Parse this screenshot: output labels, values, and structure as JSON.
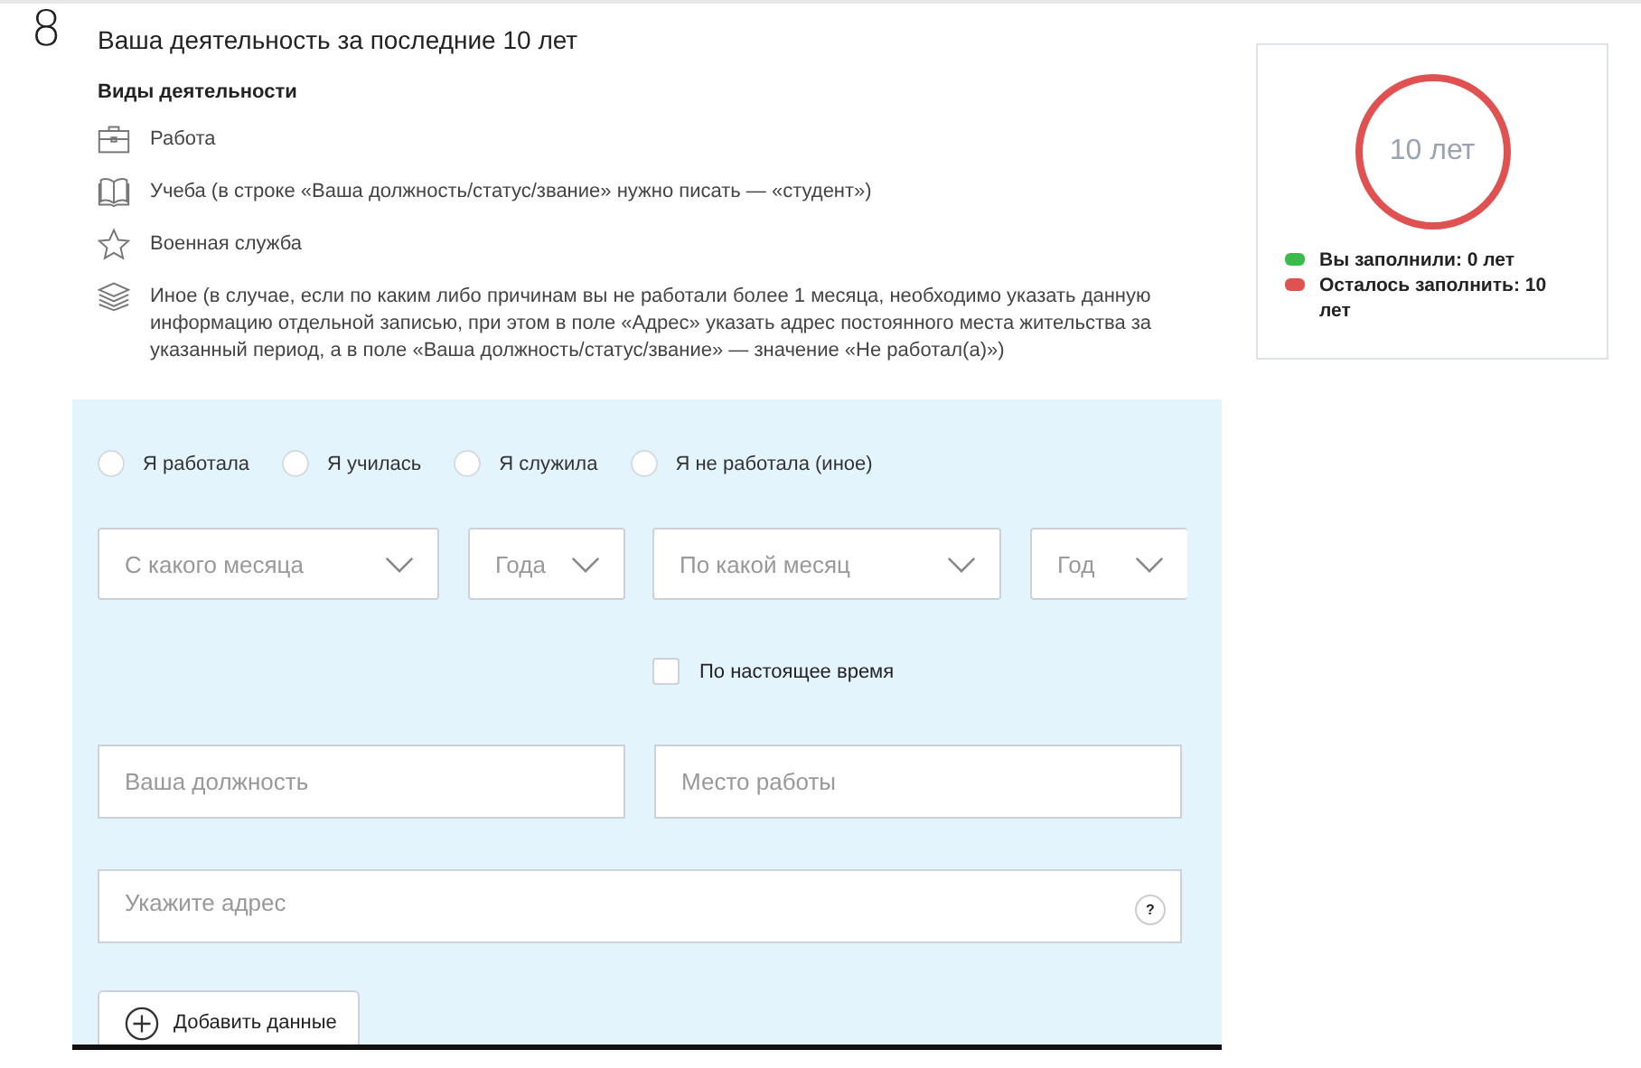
{
  "section": {
    "number": "8",
    "title": "Ваша деятельность за последние 10 лет"
  },
  "activities": {
    "heading": "Виды деятельности",
    "items": [
      {
        "kind": "work",
        "text": "Работа"
      },
      {
        "kind": "study",
        "text": "Учеба (в строке «Ваша должность/статус/звание» нужно писать — «студент»)"
      },
      {
        "kind": "military",
        "text": "Военная служба"
      },
      {
        "kind": "other",
        "text": "Иное (в случае, если по каким либо причинам вы не работали более 1 месяца, необходимо указать данную информацию отдельной записью, при этом в поле «Адрес» указать адрес постоянного места жительства за указанный период, а в поле «Ваша должность/статус/звание» — значение «Не работал(а)»)"
      }
    ]
  },
  "form": {
    "radios": [
      {
        "label": "Я работала",
        "selected": false
      },
      {
        "label": "Я училась",
        "selected": false
      },
      {
        "label": "Я служила",
        "selected": false
      },
      {
        "label": "Я не работала (иное)",
        "selected": false
      }
    ],
    "selects": [
      {
        "placeholder": "С какого месяца"
      },
      {
        "placeholder": "Года"
      },
      {
        "placeholder": "По какой месяц"
      },
      {
        "placeholder": "Год"
      }
    ],
    "until_now": {
      "label": "По настоящее время",
      "checked": false
    },
    "position": {
      "placeholder": "Ваша должность"
    },
    "workplace": {
      "placeholder": "Место работы"
    },
    "address": {
      "placeholder": "Укажите адрес",
      "help": "?"
    },
    "add_button": "Добавить данные"
  },
  "summary": {
    "total": "10 лет",
    "legend": [
      {
        "label": "Вы заполнили: 0 лет",
        "color": "#3cbb4a"
      },
      {
        "label": "Осталось заполнить: 10 лет",
        "color": "#e05252"
      }
    ]
  }
}
